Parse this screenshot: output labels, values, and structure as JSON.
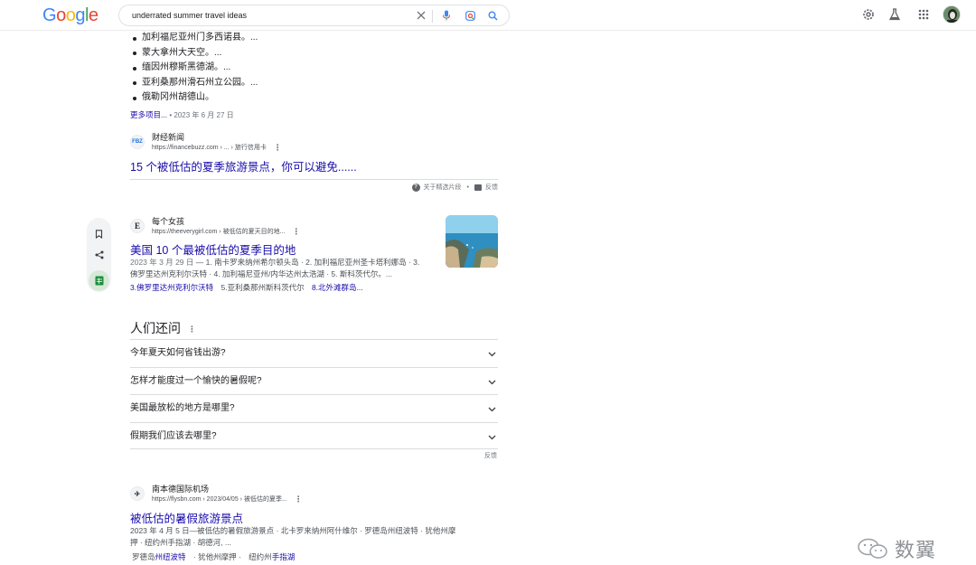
{
  "header": {
    "logo": [
      "G",
      "o",
      "o",
      "g",
      "l",
      "e"
    ],
    "search_value": "underrated summer travel ideas",
    "icons": [
      "clear-icon",
      "mic-icon",
      "lens-icon",
      "search-icon",
      "settings-icon",
      "labs-icon",
      "apps-icon",
      "avatar"
    ]
  },
  "bullets": [
    "加利福尼亚州门多西诺县。...",
    "蒙大拿州大天空。...",
    "缅因州穆斯黑德湖。...",
    "亚利桑那州滑石州立公园。...",
    "俄勒冈州胡德山。"
  ],
  "more_row": {
    "link": "更多项目...",
    "separator": "•",
    "date": "2023 年 6 月 27 日"
  },
  "result1": {
    "favicon": "FBZ",
    "site": "财经新闻",
    "url": "https://financebuzz.com › ... › 旅行信用卡",
    "title": "15 个被低估的夏季旅游景点，你可以避免......"
  },
  "featured_footer": {
    "about": "关于精选片段",
    "dot": "•",
    "feedback": "反馈"
  },
  "result2": {
    "favicon": "E",
    "site": "每个女孩",
    "url": "https://theeverygirl.com › 被低估的夏天目的地...",
    "title": "美国 10 个最被低估的夏季目的地",
    "date": "2023 年 3 月 29 日",
    "snippet_1": " — 1. 南卡罗来纳州希尔顿头岛 · 2. 加利福尼亚州圣卡塔利娜岛 · 3.",
    "snippet_2": "佛罗里达州克利尔沃特 · 4. 加利福尼亚州/内华达州太浩湖 · 5. 斯科茨代尔。...",
    "sitelink_1": "3.佛罗里达州克利尔沃特",
    "sitelink_2_prefix": "5.",
    "sitelink_2": "亚利桑那州斯科茨代尔",
    "sitelink_3": "8.北外滩群岛..."
  },
  "paa": {
    "title": "人们还问",
    "questions": [
      "今年夏天如何省钱出游?",
      "怎样才能度过一个愉快的暑假呢?",
      "美国最放松的地方是哪里?",
      "假期我们应该去哪里?"
    ],
    "feedback": "反馈"
  },
  "result3": {
    "favicon": "✈",
    "site": "南本德国际机场",
    "url": "https://flysbn.com › 2023/04/05 › 被低估的夏季...",
    "title": "被低估的暑假旅游景点",
    "snippet_1": "2023 年 4 月 5 日—被低估的暑假旅游景点 · 北卡罗来纳州阿什维尔 · 罗德岛州纽波特 · 犹他州摩",
    "snippet_2": "押 · 纽约州手指湖 · 胡德河, ...",
    "sitelink_1_prefix": "罗德岛",
    "sitelink_1": "州纽波特",
    "sitelink_2": "· 犹他州摩押 ·",
    "sitelink_3_prefix": "纽约州",
    "sitelink_3": "手指湖"
  },
  "watermark": "数翼",
  "colors": {
    "link": "#1a0dab",
    "text": "#202124",
    "secondary": "#4d5156",
    "muted": "#70757a",
    "divider": "#dadce0"
  }
}
